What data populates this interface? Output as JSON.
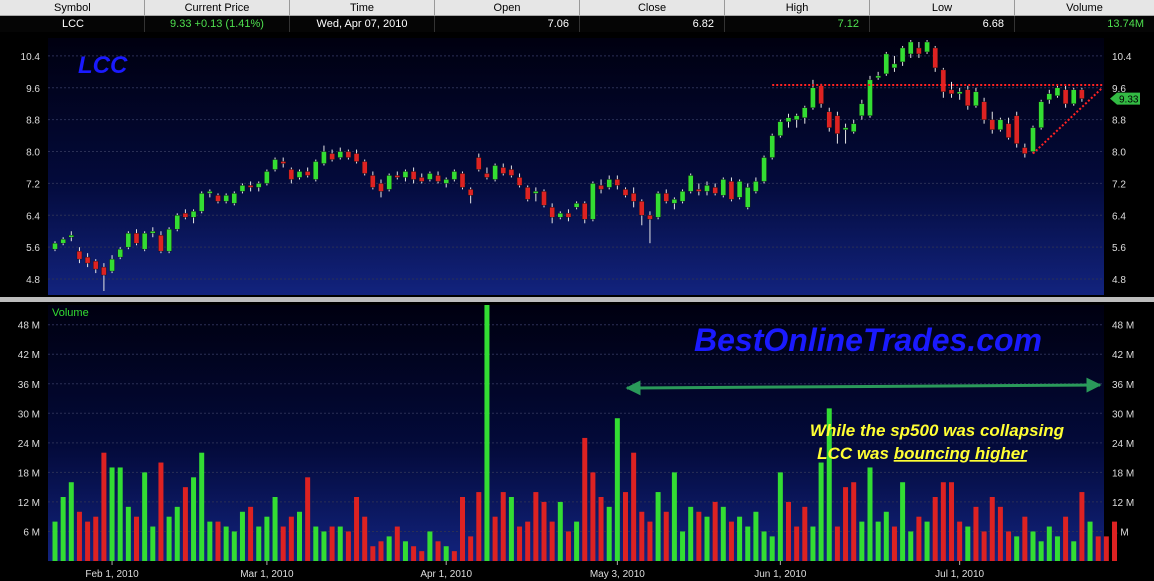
{
  "quote_bar": {
    "headers": [
      "Symbol",
      "Current Price",
      "Time",
      "Open",
      "Close",
      "High",
      "Low",
      "Volume"
    ],
    "symbol": "LCC",
    "current_price": "9.33",
    "change": "+0.13 (1.41%)",
    "time": "Wed, Apr 07, 2010",
    "open": "7.06",
    "close": "6.82",
    "high": "7.12",
    "low": "6.68",
    "volume": "13.74M"
  },
  "colors": {
    "up": "#33dd33",
    "down": "#dd2222",
    "title_text": "#1a1aff",
    "annotation_text": "#ffff33",
    "arrow": "#2a9a5a",
    "resistance_line": "#ff2222",
    "volume_label": "#33dd33"
  },
  "chart_data": [
    {
      "type": "candlestick",
      "title": "LCC",
      "ylim": [
        4.4,
        10.85
      ],
      "y_ticks": [
        "4.8",
        "5.6",
        "6.4",
        "7.2",
        "8.0",
        "8.8",
        "9.6",
        "10.4"
      ],
      "x_ticks": [
        {
          "label": "Feb 1, 2010",
          "index": 7
        },
        {
          "label": "Mar 1, 2010",
          "index": 26
        },
        {
          "label": "Apr 1, 2010",
          "index": 48
        },
        {
          "label": "May 3, 2010",
          "index": 69
        },
        {
          "label": "Jun 1, 2010",
          "index": 89
        },
        {
          "label": "Jul 1, 2010",
          "index": 111
        }
      ],
      "last_price_label": "9.33",
      "grid": true,
      "ohlc": [
        [
          5.55,
          5.75,
          5.5,
          5.7
        ],
        [
          5.7,
          5.85,
          5.65,
          5.8
        ],
        [
          5.85,
          6.0,
          5.75,
          5.9
        ],
        [
          5.5,
          5.6,
          5.2,
          5.3
        ],
        [
          5.35,
          5.45,
          5.1,
          5.2
        ],
        [
          5.25,
          5.3,
          4.95,
          5.05
        ],
        [
          5.1,
          5.2,
          4.5,
          4.9
        ],
        [
          5.0,
          5.4,
          4.95,
          5.3
        ],
        [
          5.35,
          5.6,
          5.3,
          5.55
        ],
        [
          5.6,
          6.0,
          5.55,
          5.95
        ],
        [
          5.95,
          6.05,
          5.65,
          5.7
        ],
        [
          5.55,
          6.0,
          5.5,
          5.95
        ],
        [
          5.95,
          6.1,
          5.85,
          6.0
        ],
        [
          5.9,
          6.0,
          5.45,
          5.5
        ],
        [
          5.5,
          6.1,
          5.45,
          6.05
        ],
        [
          6.05,
          6.45,
          6.0,
          6.4
        ],
        [
          6.45,
          6.55,
          6.3,
          6.35
        ],
        [
          6.35,
          6.55,
          6.2,
          6.5
        ],
        [
          6.5,
          7.0,
          6.45,
          6.95
        ],
        [
          6.95,
          7.05,
          6.85,
          7.0
        ],
        [
          6.9,
          6.95,
          6.7,
          6.75
        ],
        [
          6.75,
          6.95,
          6.7,
          6.9
        ],
        [
          6.7,
          7.0,
          6.65,
          6.95
        ],
        [
          7.0,
          7.2,
          6.95,
          7.15
        ],
        [
          7.15,
          7.25,
          7.0,
          7.1
        ],
        [
          7.1,
          7.25,
          7.0,
          7.2
        ],
        [
          7.2,
          7.55,
          7.15,
          7.5
        ],
        [
          7.55,
          7.85,
          7.5,
          7.8
        ],
        [
          7.75,
          7.85,
          7.6,
          7.7
        ],
        [
          7.55,
          7.6,
          7.2,
          7.3
        ],
        [
          7.35,
          7.55,
          7.3,
          7.5
        ],
        [
          7.5,
          7.6,
          7.35,
          7.4
        ],
        [
          7.3,
          7.8,
          7.25,
          7.75
        ],
        [
          7.7,
          8.15,
          7.65,
          8.0
        ],
        [
          7.95,
          8.05,
          7.75,
          7.8
        ],
        [
          7.85,
          8.1,
          7.8,
          8.0
        ],
        [
          8.0,
          8.05,
          7.8,
          7.85
        ],
        [
          7.95,
          8.05,
          7.7,
          7.75
        ],
        [
          7.75,
          7.8,
          7.4,
          7.45
        ],
        [
          7.4,
          7.5,
          7.05,
          7.1
        ],
        [
          7.2,
          7.3,
          6.85,
          7.0
        ],
        [
          7.05,
          7.45,
          7.0,
          7.4
        ],
        [
          7.4,
          7.5,
          7.3,
          7.35
        ],
        [
          7.35,
          7.55,
          7.25,
          7.5
        ],
        [
          7.5,
          7.6,
          7.2,
          7.3
        ],
        [
          7.35,
          7.45,
          7.2,
          7.25
        ],
        [
          7.3,
          7.5,
          7.25,
          7.45
        ],
        [
          7.4,
          7.5,
          7.2,
          7.25
        ],
        [
          7.2,
          7.35,
          7.1,
          7.3
        ],
        [
          7.3,
          7.55,
          7.25,
          7.5
        ],
        [
          7.45,
          7.5,
          7.05,
          7.1
        ],
        [
          7.05,
          7.1,
          6.7,
          6.9
        ],
        [
          7.85,
          7.95,
          7.5,
          7.55
        ],
        [
          7.45,
          7.6,
          7.3,
          7.35
        ],
        [
          7.3,
          7.7,
          7.25,
          7.65
        ],
        [
          7.6,
          7.7,
          7.4,
          7.45
        ],
        [
          7.55,
          7.65,
          7.35,
          7.4
        ],
        [
          7.35,
          7.45,
          7.1,
          7.15
        ],
        [
          7.1,
          7.15,
          6.75,
          6.8
        ],
        [
          6.95,
          7.1,
          6.75,
          7.0
        ],
        [
          7.0,
          7.05,
          6.6,
          6.65
        ],
        [
          6.6,
          6.7,
          6.2,
          6.35
        ],
        [
          6.35,
          6.5,
          6.3,
          6.45
        ],
        [
          6.45,
          6.55,
          6.25,
          6.35
        ],
        [
          6.6,
          6.75,
          6.55,
          6.7
        ],
        [
          6.7,
          6.75,
          6.2,
          6.3
        ],
        [
          6.3,
          7.25,
          6.25,
          7.2
        ],
        [
          7.15,
          7.3,
          6.95,
          7.05
        ],
        [
          7.1,
          7.4,
          7.05,
          7.3
        ],
        [
          7.3,
          7.4,
          7.05,
          7.15
        ],
        [
          7.05,
          7.1,
          6.85,
          6.9
        ],
        [
          6.95,
          7.1,
          6.6,
          6.75
        ],
        [
          6.75,
          6.8,
          6.15,
          6.4
        ],
        [
          6.4,
          6.5,
          5.7,
          6.3
        ],
        [
          6.35,
          7.0,
          6.3,
          6.95
        ],
        [
          6.95,
          7.05,
          6.7,
          6.75
        ],
        [
          6.7,
          6.85,
          6.55,
          6.8
        ],
        [
          6.75,
          7.05,
          6.7,
          7.0
        ],
        [
          7.0,
          7.45,
          6.95,
          7.4
        ],
        [
          7.05,
          7.2,
          6.9,
          7.0
        ],
        [
          7.0,
          7.25,
          6.9,
          7.15
        ],
        [
          7.1,
          7.2,
          6.9,
          6.95
        ],
        [
          6.9,
          7.35,
          6.85,
          7.3
        ],
        [
          7.25,
          7.35,
          6.75,
          6.8
        ],
        [
          6.85,
          7.3,
          6.8,
          7.25
        ],
        [
          6.6,
          7.2,
          6.55,
          7.1
        ],
        [
          7.0,
          7.35,
          6.95,
          7.25
        ],
        [
          7.25,
          7.9,
          7.2,
          7.85
        ],
        [
          7.85,
          8.45,
          7.8,
          8.4
        ],
        [
          8.4,
          8.8,
          8.35,
          8.75
        ],
        [
          8.75,
          8.95,
          8.6,
          8.85
        ],
        [
          8.8,
          8.95,
          8.6,
          8.9
        ],
        [
          8.85,
          9.15,
          8.7,
          9.1
        ],
        [
          9.1,
          9.8,
          9.05,
          9.6
        ],
        [
          9.65,
          9.7,
          9.1,
          9.2
        ],
        [
          9.0,
          9.1,
          8.5,
          8.6
        ],
        [
          8.9,
          9.0,
          8.2,
          8.45
        ],
        [
          8.55,
          8.7,
          8.2,
          8.6
        ],
        [
          8.5,
          8.8,
          8.45,
          8.7
        ],
        [
          8.9,
          9.3,
          8.8,
          9.2
        ],
        [
          8.9,
          9.9,
          8.85,
          9.8
        ],
        [
          9.85,
          10.0,
          9.8,
          9.9
        ],
        [
          9.95,
          10.5,
          9.9,
          10.45
        ],
        [
          10.1,
          10.4,
          10.0,
          10.2
        ],
        [
          10.25,
          10.65,
          10.15,
          10.6
        ],
        [
          10.45,
          10.8,
          10.35,
          10.75
        ],
        [
          10.6,
          10.75,
          10.35,
          10.45
        ],
        [
          10.5,
          10.8,
          10.45,
          10.75
        ],
        [
          10.6,
          10.65,
          10.0,
          10.1
        ],
        [
          10.05,
          10.1,
          9.35,
          9.5
        ],
        [
          9.55,
          9.75,
          9.35,
          9.45
        ],
        [
          9.45,
          9.6,
          9.3,
          9.5
        ],
        [
          9.55,
          9.65,
          9.05,
          9.15
        ],
        [
          9.15,
          9.6,
          9.1,
          9.5
        ],
        [
          9.25,
          9.35,
          8.7,
          8.8
        ],
        [
          8.8,
          9.0,
          8.45,
          8.55
        ],
        [
          8.55,
          8.85,
          8.5,
          8.8
        ],
        [
          8.7,
          8.85,
          8.3,
          8.35
        ],
        [
          8.9,
          9.0,
          8.1,
          8.2
        ],
        [
          8.1,
          8.2,
          7.85,
          7.95
        ],
        [
          8.0,
          8.65,
          7.95,
          8.6
        ],
        [
          8.6,
          9.3,
          8.55,
          9.25
        ],
        [
          9.3,
          9.55,
          9.2,
          9.45
        ],
        [
          9.4,
          9.65,
          9.35,
          9.6
        ],
        [
          9.55,
          9.65,
          9.1,
          9.2
        ],
        [
          9.2,
          9.6,
          9.15,
          9.55
        ],
        [
          9.55,
          9.6,
          9.25,
          9.33
        ]
      ]
    },
    {
      "type": "bar",
      "title": "Volume",
      "ylim": [
        0,
        52
      ],
      "y_ticks": [
        "6 M",
        "12 M",
        "18 M",
        "24 M",
        "30 M",
        "36 M",
        "42 M",
        "48 M"
      ],
      "values": [
        8,
        13,
        16,
        10,
        8,
        9,
        22,
        19,
        19,
        11,
        9,
        18,
        7,
        20,
        9,
        11,
        15,
        17,
        22,
        8,
        8,
        7,
        6,
        10,
        11,
        7,
        9,
        13,
        7,
        9,
        10,
        17,
        7,
        6,
        7,
        7,
        6,
        13,
        9,
        3,
        4,
        5,
        7,
        4,
        3,
        2,
        6,
        4,
        3,
        2,
        13,
        5,
        14,
        52,
        9,
        14,
        13,
        7,
        8,
        14,
        12,
        8,
        12,
        6,
        8,
        25,
        18,
        13,
        11,
        29,
        14,
        22,
        10,
        8,
        14,
        10,
        18,
        6,
        11,
        10,
        9,
        12,
        11,
        8,
        9,
        7,
        10,
        6,
        5,
        18,
        12,
        7,
        11,
        7,
        20,
        31,
        7,
        15,
        16,
        8,
        19,
        8,
        10,
        7,
        16,
        6,
        9,
        8,
        13,
        16,
        16,
        8,
        7,
        11,
        6,
        13,
        11,
        6,
        5,
        9,
        6,
        4,
        7,
        5,
        9,
        4,
        14,
        8,
        5,
        5,
        8
      ],
      "up": [
        1,
        1,
        1,
        0,
        0,
        0,
        0,
        1,
        1,
        1,
        0,
        1,
        1,
        0,
        1,
        1,
        0,
        1,
        1,
        1,
        0,
        1,
        1,
        1,
        0,
        1,
        1,
        1,
        0,
        0,
        1,
        0,
        1,
        1,
        0,
        1,
        0,
        0,
        0,
        0,
        0,
        1,
        0,
        1,
        0,
        0,
        1,
        0,
        1,
        0,
        0,
        0,
        0,
        1,
        0,
        0,
        1,
        0,
        0,
        0,
        0,
        0,
        1,
        0,
        1,
        0,
        0,
        0,
        1,
        1,
        0,
        0,
        0,
        0,
        1,
        0,
        1,
        1,
        1,
        0,
        1,
        0,
        1,
        0,
        1,
        1,
        1,
        1,
        1,
        1,
        0,
        0,
        0,
        1,
        1,
        1,
        0,
        0,
        0,
        1,
        1,
        1,
        1,
        0,
        1,
        1,
        0,
        1,
        0,
        0,
        0,
        0,
        1,
        0,
        0,
        0,
        0,
        0,
        1,
        0,
        1,
        1,
        1,
        1,
        0,
        1,
        0,
        1,
        0
      ]
    }
  ],
  "annotations": {
    "watermark": "BestOnlineTrades.com",
    "note_line1": "While the sp500 was collapsing",
    "note_line2_prefix": "LCC was ",
    "note_line2_underlined": "bouncing higher"
  }
}
